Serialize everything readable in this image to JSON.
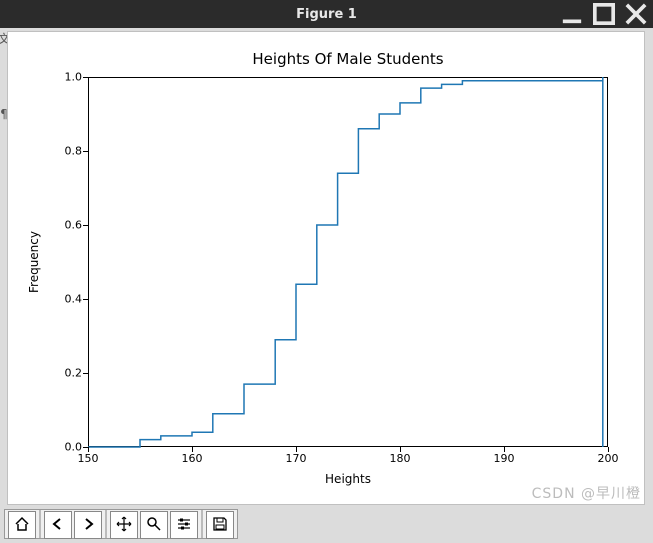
{
  "window": {
    "title": "Figure 1",
    "minimize_tip": "Minimize",
    "maximize_tip": "Maximize",
    "close_tip": "Close"
  },
  "chart_data": {
    "type": "line",
    "title": "Heights Of Male Students",
    "xlabel": "Heights",
    "ylabel": "Frequency",
    "xlim": [
      150,
      200
    ],
    "ylim": [
      0.0,
      1.0
    ],
    "xticks": [
      150,
      160,
      170,
      180,
      190,
      200
    ],
    "yticks": [
      0.0,
      0.2,
      0.4,
      0.6,
      0.8,
      1.0
    ],
    "step_x": [
      150,
      153,
      155,
      157,
      160,
      162,
      165,
      168,
      170,
      172,
      174,
      176,
      178,
      180,
      182,
      184,
      186,
      199.5,
      199.5
    ],
    "step_y": [
      0.0,
      0.0,
      0.02,
      0.03,
      0.04,
      0.09,
      0.17,
      0.29,
      0.44,
      0.6,
      0.74,
      0.86,
      0.9,
      0.93,
      0.97,
      0.98,
      0.99,
      1.0,
      0.0
    ]
  },
  "toolbar": {
    "home": "Home",
    "back": "Back",
    "forward": "Forward",
    "pan": "Pan",
    "zoom": "Zoom",
    "config": "Configure",
    "save": "Save"
  },
  "watermark": "CSDN @早川橙"
}
